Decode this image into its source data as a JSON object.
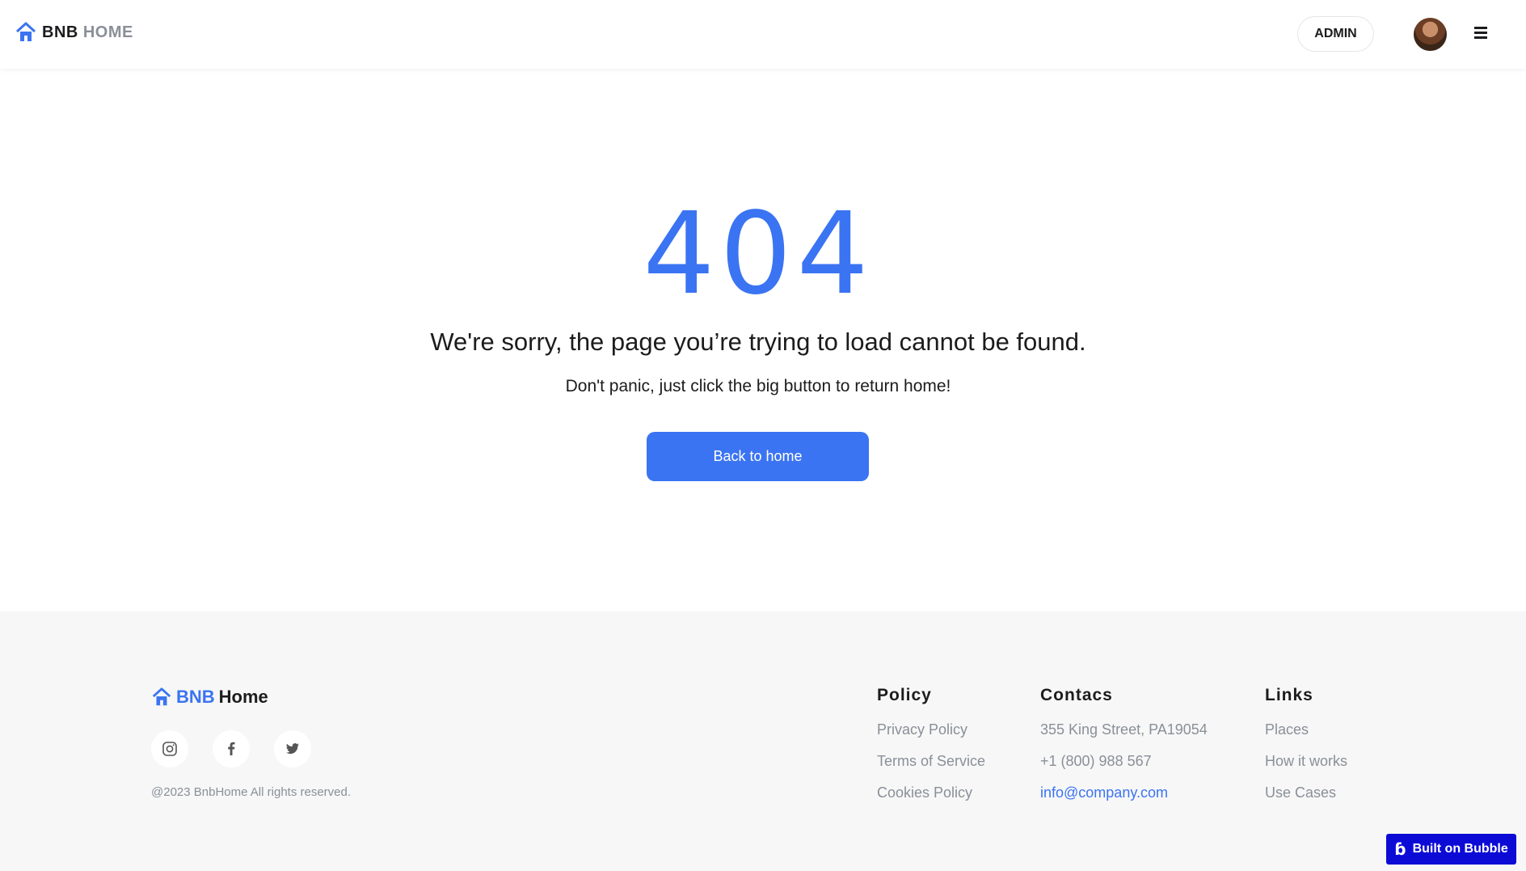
{
  "header": {
    "logo_bnb": "BNB",
    "logo_home": "HOME",
    "admin_label": "ADMIN",
    "icons": {
      "logo": "house-icon",
      "avatar": "user-avatar",
      "menu": "hamburger-menu-icon"
    }
  },
  "main": {
    "code": "404",
    "title": "We're sorry, the page you’re trying to load cannot be found.",
    "subtitle": "Don't panic, just click the big button to return home!",
    "button_label": "Back to home"
  },
  "footer": {
    "logo_bnb": "BNB",
    "logo_home": "Home",
    "socials": [
      "instagram-icon",
      "facebook-icon",
      "twitter-icon"
    ],
    "copyright": "@2023 BnbHome All rights reserved.",
    "policy": {
      "heading": "Policy",
      "items": [
        "Privacy Policy",
        "Terms of Service",
        "Cookies Policy"
      ]
    },
    "contacts": {
      "heading": "Contacs",
      "address": "355 King Street, PA19054",
      "phone": "+1 (800) 988 567",
      "email": "info@company.com"
    },
    "links": {
      "heading": "Links",
      "items": [
        "Places",
        "How it works",
        "Use Cases"
      ]
    }
  },
  "badge": {
    "label": "Built on Bubble",
    "icon": "bubble-logo-icon"
  },
  "colors": {
    "accent": "#3b74f2",
    "text": "#1c1c1e",
    "muted": "#8a8f98",
    "footer_bg": "#f7f7f7",
    "bubble": "#0c0bd6"
  }
}
